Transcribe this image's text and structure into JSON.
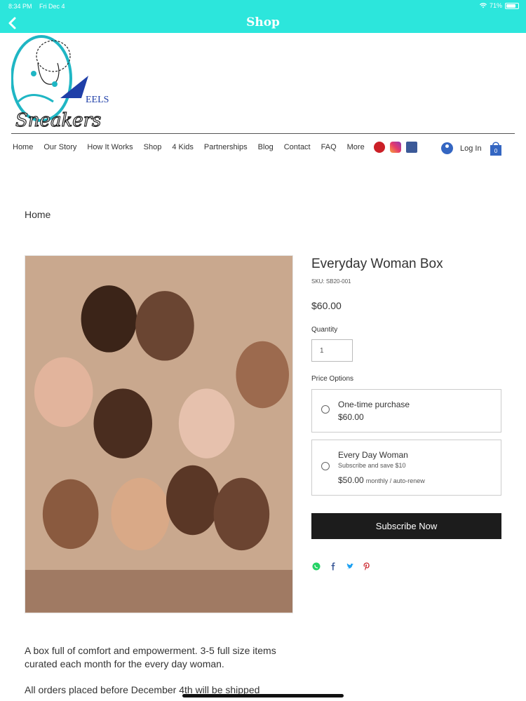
{
  "status": {
    "time": "8:34 PM",
    "date": "Fri Dec 4",
    "battery": "71%"
  },
  "header": {
    "title": "Shop"
  },
  "logo": {
    "text_top": "EELS",
    "text_script": "Sneakers"
  },
  "nav": {
    "items": [
      "Home",
      "Our Story",
      "How It Works",
      "Shop",
      "4 Kids",
      "Partnerships",
      "Blog",
      "Contact",
      "FAQ",
      "More"
    ]
  },
  "social": {
    "icons": [
      "pinterest-icon",
      "instagram-icon",
      "facebook-icon"
    ]
  },
  "account": {
    "login_label": "Log In",
    "cart_count": "0"
  },
  "breadcrumb": "Home",
  "product": {
    "title": "Everyday Woman Box",
    "sku": "SKU: SB20-001",
    "price": "$60.00",
    "quantity_label": "Quantity",
    "quantity_value": "1",
    "price_options_label": "Price Options",
    "options": [
      {
        "name": "One-time purchase",
        "price": "$60.00"
      },
      {
        "name": "Every Day Woman",
        "subtitle": "Subscribe and save $10",
        "price": "$50.00",
        "frequency": "monthly / auto-renew"
      }
    ],
    "cta_label": "Subscribe Now",
    "share_icons": [
      "whatsapp-icon",
      "facebook-icon",
      "twitter-icon",
      "pinterest-icon"
    ],
    "description": "A box full of comfort and empowerment. 3-5 full size items curated each month for the every day woman.",
    "shipping_note": "All orders placed before December 4th will be shipped"
  },
  "colors": {
    "header": "#2ce6dc",
    "button": "#1c1c1c",
    "link_blue": "#3466c2"
  }
}
